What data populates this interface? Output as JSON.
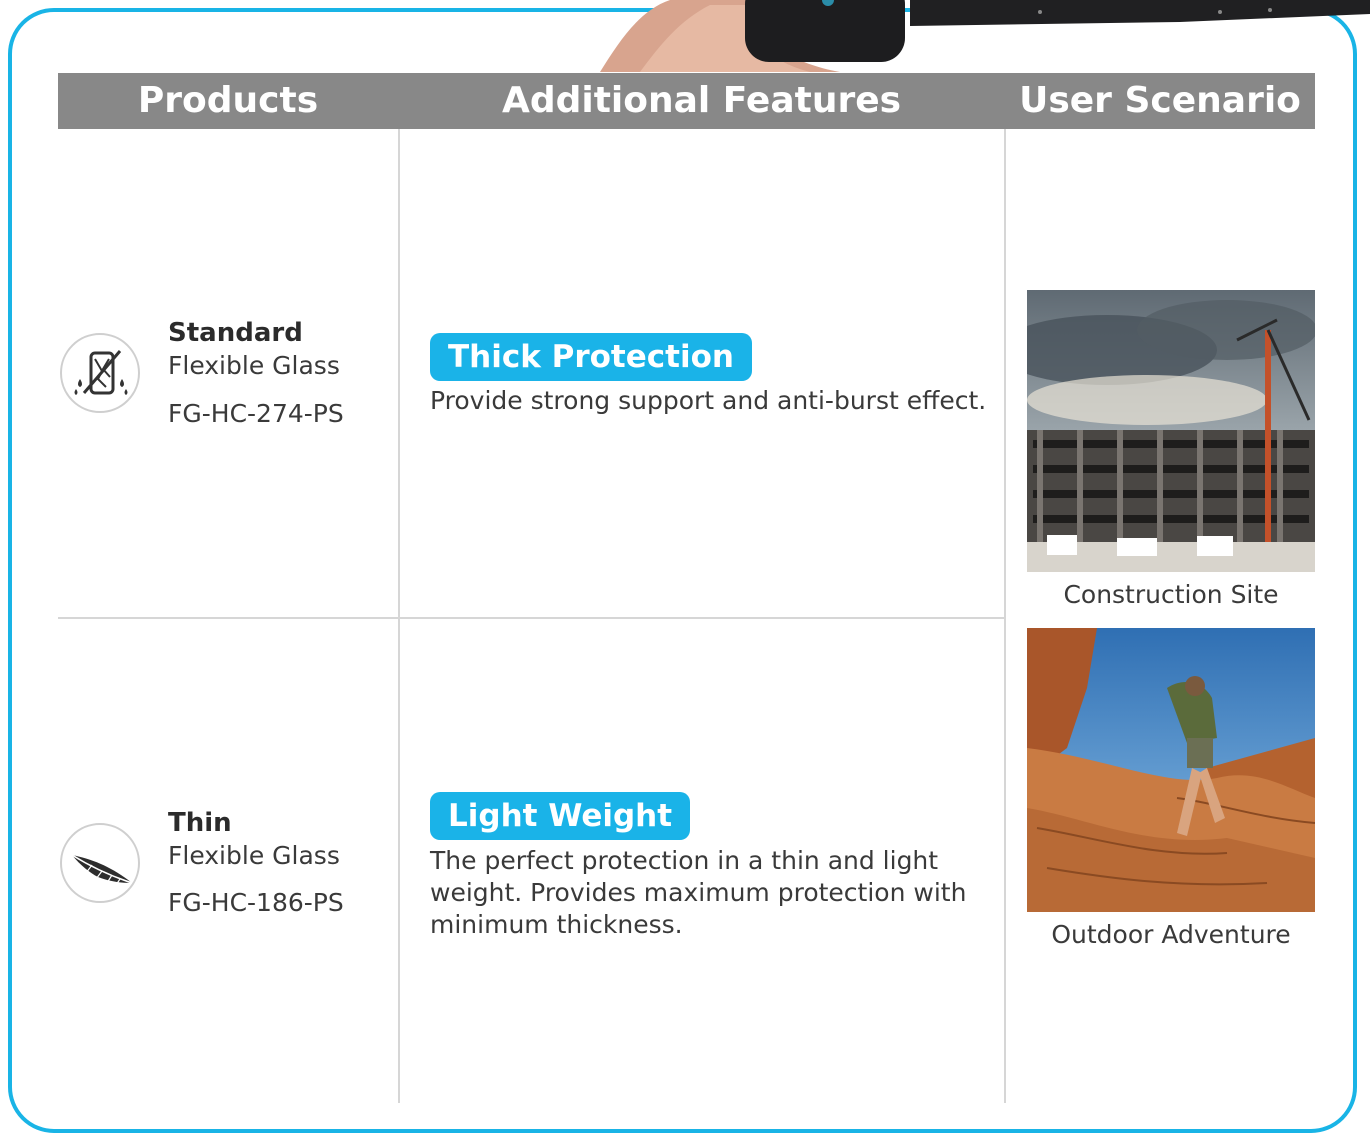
{
  "header": {
    "col_products": "Products",
    "col_features": "Additional Features",
    "col_scenario": "User Scenario"
  },
  "rows": [
    {
      "name": "Standard",
      "type": "Flexible Glass",
      "code": "FG-HC-274-PS",
      "icon": "shatter-proof-phone-icon",
      "feature": "Thick Protection",
      "description": "Provide strong support and anti-burst effect."
    },
    {
      "name": "Thin",
      "type": "Flexible Glass",
      "code": "FG-HC-186-PS",
      "icon": "feather-icon",
      "feature": "Light Weight",
      "description": "The perfect protection in a thin and light weight. Provides maximum protection with minimum thickness."
    }
  ],
  "scenarios": [
    {
      "caption": "Construction Site"
    },
    {
      "caption": "Outdoor Adventure"
    }
  ],
  "colors": {
    "accent": "#1ab3e8",
    "header_bg": "#888888",
    "frame": "#19b4e6"
  }
}
